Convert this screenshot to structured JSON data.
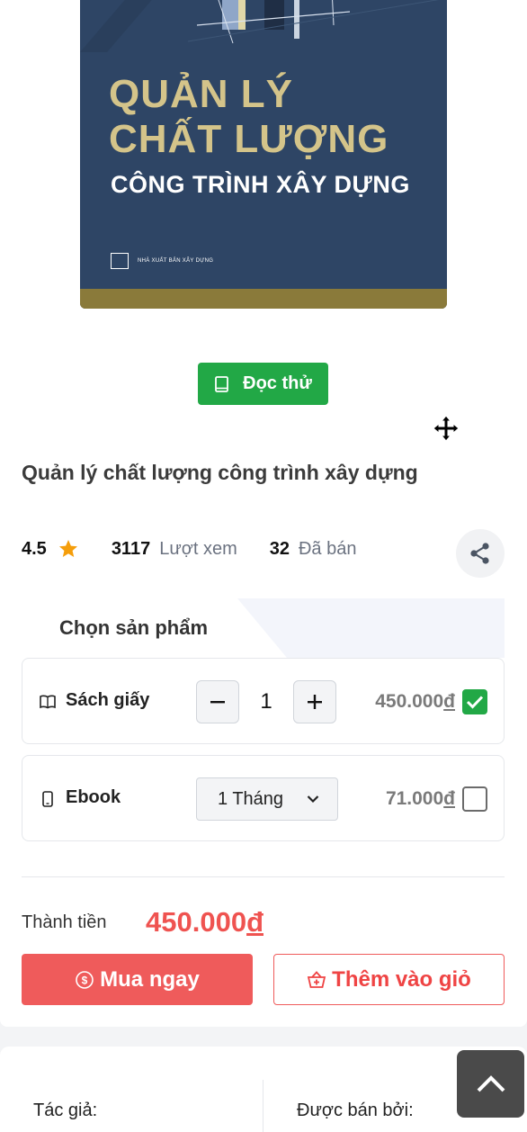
{
  "cover": {
    "title_line1": "QUẢN LÝ",
    "title_line2": "CHẤT LƯỢNG",
    "subtitle": "CÔNG TRÌNH XÂY DỰNG",
    "publisher": "NHÀ XUẤT BẢN XÂY DỰNG"
  },
  "read_button": {
    "label": "Đọc thử",
    "icon": "book-icon",
    "color": "#22a846"
  },
  "product": {
    "title": "Quản lý chất lượng công trình xây dựng"
  },
  "stats": {
    "rating": "4.5",
    "views_count": "3117",
    "views_label": "Lượt xem",
    "sold_count": "32",
    "sold_label": "Đã bán"
  },
  "choose": {
    "heading": "Chọn sản phẩm",
    "options": [
      {
        "name": "Sách giấy",
        "icon": "open-book-icon",
        "quantity": "1",
        "price": "450.000",
        "currency": "đ",
        "selected": true
      },
      {
        "name": "Ebook",
        "icon": "phone-icon",
        "duration": "1 Tháng",
        "price": "71.000",
        "currency": "đ",
        "selected": false
      }
    ]
  },
  "total": {
    "label": "Thành tiền",
    "value": "450.000",
    "currency": "đ",
    "color": "#ef5350"
  },
  "actions": {
    "buy_label": "Mua ngay",
    "add_cart_label": "Thêm vào giỏ"
  },
  "info": {
    "author_label": "Tác giả:",
    "seller_label": "Được bán bởi:"
  },
  "colors": {
    "accent": "#ef5b5b",
    "green": "#22a846",
    "cover_bg": "#2e4565",
    "cover_gold": "#d4c48a"
  }
}
